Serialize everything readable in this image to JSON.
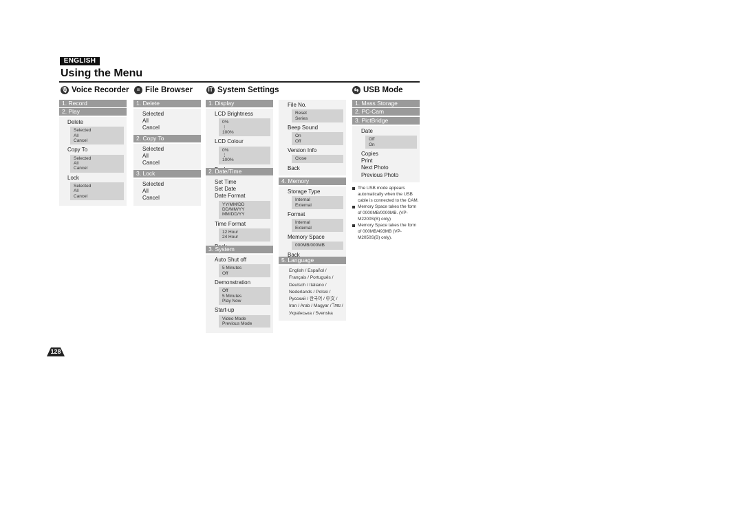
{
  "language_badge": "ENGLISH",
  "title": "Using the Menu",
  "page_number": "128",
  "voice_recorder": {
    "heading": "Voice Recorder",
    "icon": "microphone-icon",
    "sections": [
      {
        "bar": "1. Record"
      },
      {
        "bar": "2. Play",
        "items": [
          {
            "label": "Delete",
            "options": [
              "Selected",
              "All",
              "Cancel"
            ]
          },
          {
            "label": "Copy To",
            "options": [
              "Selected",
              "All",
              "Cancel"
            ]
          },
          {
            "label": "Lock",
            "options": [
              "Selected",
              "All",
              "Cancel"
            ]
          }
        ]
      }
    ]
  },
  "file_browser": {
    "heading": "File Browser",
    "icon": "file-icon",
    "sections": [
      {
        "bar": "1. Delete",
        "items": [
          {
            "label": "Selected"
          },
          {
            "label": "All"
          },
          {
            "label": "Cancel"
          }
        ]
      },
      {
        "bar": "2. Copy To",
        "items": [
          {
            "label": "Selected"
          },
          {
            "label": "All"
          },
          {
            "label": "Cancel"
          }
        ]
      },
      {
        "bar": "3. Lock",
        "items": [
          {
            "label": "Selected"
          },
          {
            "label": "All"
          },
          {
            "label": "Cancel"
          }
        ]
      }
    ]
  },
  "system_settings": {
    "heading": "System Settings",
    "icon": "tools-icon",
    "sections_left": [
      {
        "bar": "1. Display",
        "items": [
          {
            "label": "LCD Brightness",
            "options": [
              "0%",
              "⋮",
              "100%"
            ]
          },
          {
            "label": "LCD Colour",
            "options": [
              "0%",
              "⋮",
              "100%"
            ]
          },
          {
            "label": "Back"
          }
        ]
      },
      {
        "bar": "2. Date/Time",
        "items": [
          {
            "label": "Set Time"
          },
          {
            "label": "Set Date"
          },
          {
            "label": "Date Format",
            "options": [
              "YY/MM/DD",
              "DD/MM/YY",
              "MM/DD/YY"
            ]
          },
          {
            "label": "Time Format",
            "options": [
              "12 Hour",
              "24 Hour"
            ]
          },
          {
            "label": "Back"
          }
        ]
      },
      {
        "bar": "3. System",
        "items": [
          {
            "label": "Auto Shut off",
            "options": [
              "5 Minutes",
              "Off"
            ]
          },
          {
            "label": "Demonstration",
            "options": [
              "Off",
              "5 Minutes",
              "Play Now"
            ]
          },
          {
            "label": "Start-up",
            "options": [
              "Video Mode",
              "Previous Mode"
            ]
          }
        ]
      }
    ],
    "sections_right": [
      {
        "items": [
          {
            "label": "File No.",
            "options": [
              "Reset",
              "Series"
            ]
          },
          {
            "label": "Beep Sound",
            "options": [
              "On",
              "Off"
            ]
          },
          {
            "label": "Version Info",
            "options": [
              "Close"
            ]
          },
          {
            "label": "Back"
          }
        ]
      },
      {
        "bar": "4. Memory",
        "items": [
          {
            "label": "Storage Type",
            "options": [
              "Internal",
              "External"
            ]
          },
          {
            "label": "Format",
            "options": [
              "Internal",
              "External"
            ]
          },
          {
            "label": "Memory Space",
            "options": [
              "000MB/000MB"
            ]
          },
          {
            "label": "Back"
          }
        ]
      },
      {
        "bar": "5. Language",
        "lines": [
          "English / Español /",
          "Français / Português /",
          "Deutsch / Italiano /",
          "Nederlands / Polski /",
          "Русский / 한국어 / 中文 /",
          "Iran / Arab / Magyar / ไทย /",
          "Українська / Svenska"
        ]
      }
    ]
  },
  "usb_mode": {
    "heading": "USB Mode",
    "icon": "usb-icon",
    "sections": [
      {
        "bar": "1. Mass Storage"
      },
      {
        "bar": "2. PC-Cam"
      },
      {
        "bar": "3. PictBridge",
        "items": [
          {
            "label": "Date",
            "options": [
              "Off",
              "On"
            ]
          },
          {
            "label": "Copies"
          },
          {
            "label": "Print"
          },
          {
            "label": "Next Photo"
          },
          {
            "label": "Previous Photo"
          }
        ]
      }
    ],
    "notes": [
      "The USB mode appears automatically when the USB cable is connected to the CAM.",
      "Memory Space takes the form of 0000MB/0000MB. (VP-M2200S(B) only)",
      "Memory Space takes the form of 000MB/493MB (VP-M2050S(B) only)."
    ]
  }
}
